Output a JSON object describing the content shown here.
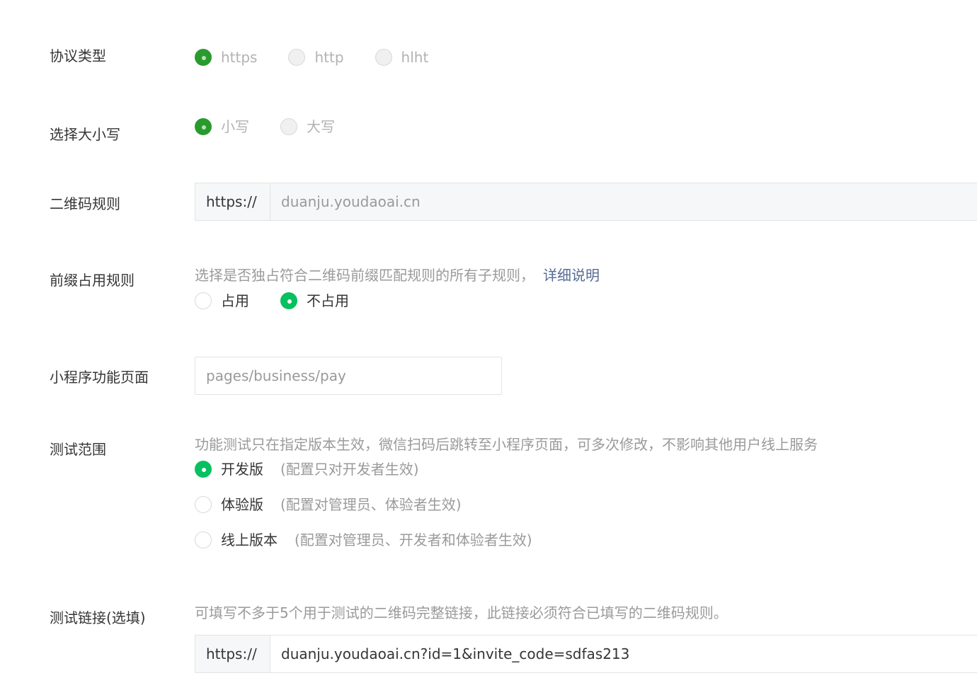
{
  "protocol": {
    "label": "协议类型",
    "options": [
      "https",
      "http",
      "hlht"
    ],
    "selected": 0
  },
  "case": {
    "label": "选择大小写",
    "options": [
      "小写",
      "大写"
    ],
    "selected": 0
  },
  "qr_rule": {
    "label": "二维码规则",
    "prefix": "https://",
    "value": "duanju.youdaoai.cn"
  },
  "prefix_rule": {
    "label": "前缀占用规则",
    "hint": "选择是否独占符合二维码前缀匹配规则的所有子规则，",
    "link": "详细说明",
    "options": [
      "占用",
      "不占用"
    ],
    "selected": 1
  },
  "page": {
    "label": "小程序功能页面",
    "value": "pages/business/pay"
  },
  "test_scope": {
    "label": "测试范围",
    "hint": "功能测试只在指定版本生效，微信扫码后跳转至小程序页面，可多次修改，不影响其他用户线上服务",
    "options": [
      {
        "label": "开发版",
        "note": "(配置只对开发者生效)"
      },
      {
        "label": "体验版",
        "note": "(配置对管理员、体验者生效)"
      },
      {
        "label": "线上版本",
        "note": "(配置对管理员、开发者和体验者生效)"
      }
    ],
    "selected": 0
  },
  "test_link": {
    "label": "测试链接(选填)",
    "hint": "可填写不多于5个用于测试的二维码完整链接，此链接必须符合已填写的二维码规则。",
    "prefix": "https://",
    "value": "duanju.youdaoai.cn?id=1&invite_code=sdfas213"
  },
  "colors": {
    "accent": "#07c160",
    "link": "#576b95",
    "text": "#353535",
    "muted": "#9a9a9a"
  }
}
